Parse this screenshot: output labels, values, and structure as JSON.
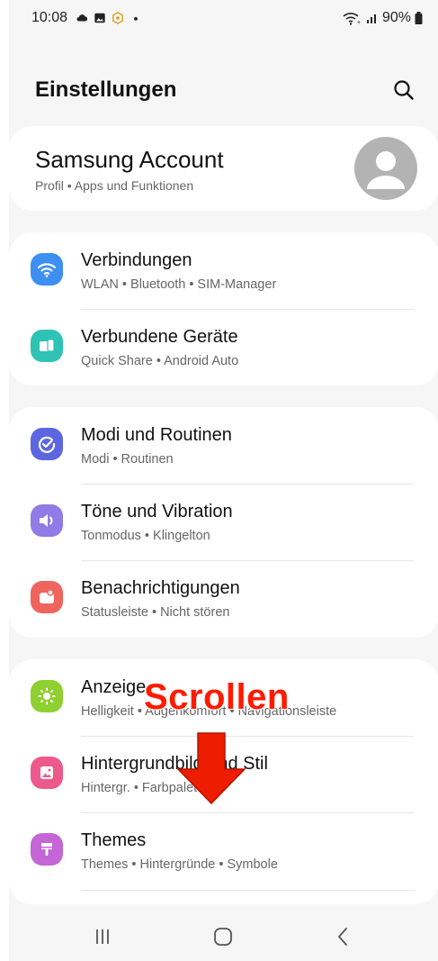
{
  "status_bar": {
    "time": "10:08",
    "battery": "90%"
  },
  "header": {
    "title": "Einstellungen"
  },
  "account": {
    "title": "Samsung Account",
    "subtitle": "Profil  •  Apps und Funktionen"
  },
  "groups": [
    [
      {
        "title": "Verbindungen",
        "subtitle": "WLAN  •  Bluetooth  •  SIM-Manager",
        "icon": "wifi-icon",
        "color": "#3d8ff2"
      },
      {
        "title": "Verbundene Geräte",
        "subtitle": "Quick Share  •  Android Auto",
        "icon": "devices-icon",
        "color": "#2ec3b5"
      }
    ],
    [
      {
        "title": "Modi und Routinen",
        "subtitle": "Modi  •  Routinen",
        "icon": "check-circle-icon",
        "color": "#5b66e0"
      },
      {
        "title": "Töne und Vibration",
        "subtitle": "Tonmodus  •  Klingelton",
        "icon": "volume-icon",
        "color": "#8f7ce6"
      },
      {
        "title": "Benachrichtigungen",
        "subtitle": "Statusleiste  •  Nicht stören",
        "icon": "notification-icon",
        "color": "#f0645e"
      }
    ],
    [
      {
        "title": "Anzeige",
        "subtitle": "Helligkeit  •  Augenkomfort  •  Navigationsleiste",
        "icon": "brightness-icon",
        "color": "#8fcf2f"
      },
      {
        "title": "Hintergrundbild und Stil",
        "subtitle": "Hintergr.  •  Farbpalette",
        "icon": "wallpaper-icon",
        "color": "#ec5a8c"
      },
      {
        "title": "Themes",
        "subtitle": "Themes  •  Hintergründe  •  Symbole",
        "icon": "theme-brush-icon",
        "color": "#c466d6"
      }
    ]
  ],
  "overlay": {
    "label": "Scrollen",
    "color": "#ff1a00"
  }
}
